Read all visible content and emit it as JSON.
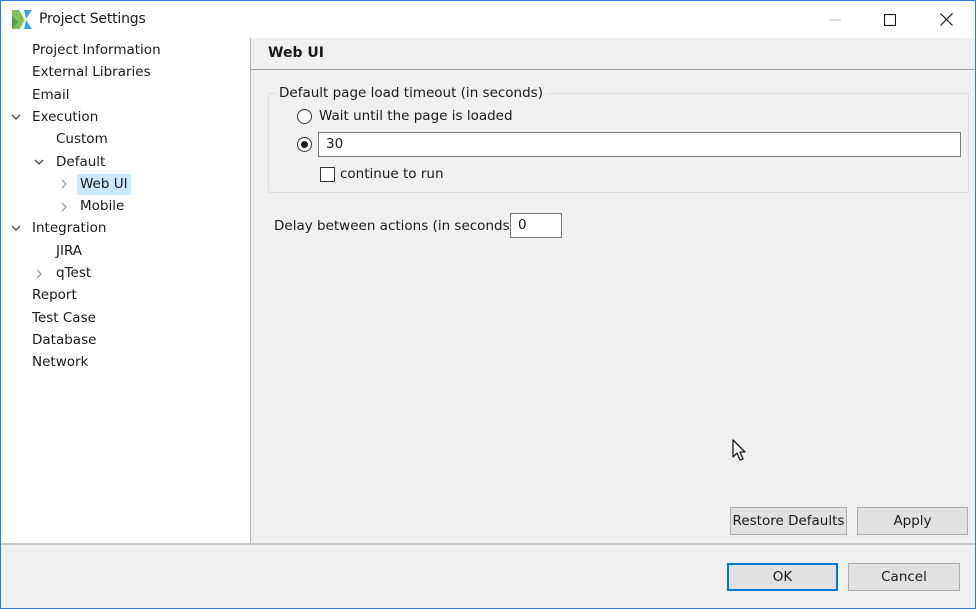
{
  "window": {
    "title": "Project Settings",
    "controls": {
      "minimize": "minimize-icon",
      "maximize": "maximize-icon",
      "close": "close-icon"
    }
  },
  "sidebar": {
    "items": [
      {
        "label": "Project Information",
        "level": 0,
        "twisty": "none"
      },
      {
        "label": "External Libraries",
        "level": 0,
        "twisty": "none"
      },
      {
        "label": "Email",
        "level": 0,
        "twisty": "none"
      },
      {
        "label": "Execution",
        "level": 0,
        "twisty": "expanded"
      },
      {
        "label": "Custom",
        "level": 1,
        "twisty": "none"
      },
      {
        "label": "Default",
        "level": 1,
        "twisty": "expanded"
      },
      {
        "label": "Web UI",
        "level": 2,
        "twisty": "collapsed",
        "selected": true
      },
      {
        "label": "Mobile",
        "level": 2,
        "twisty": "collapsed"
      },
      {
        "label": "Integration",
        "level": 0,
        "twisty": "expanded"
      },
      {
        "label": "JIRA",
        "level": 1,
        "twisty": "none"
      },
      {
        "label": "qTest",
        "level": 1,
        "twisty": "collapsed"
      },
      {
        "label": "Report",
        "level": 0,
        "twisty": "none"
      },
      {
        "label": "Test Case",
        "level": 0,
        "twisty": "none"
      },
      {
        "label": "Database",
        "level": 0,
        "twisty": "none"
      },
      {
        "label": "Network",
        "level": 0,
        "twisty": "none"
      }
    ]
  },
  "main": {
    "title": "Web UI",
    "timeout_group": {
      "legend": "Default page load timeout (in seconds)",
      "wait_option_label": "Wait until the page is loaded",
      "wait_option_checked": false,
      "custom_option_checked": true,
      "custom_value": "30",
      "continue_label": "continue to run",
      "continue_checked": false
    },
    "delay": {
      "label": "Delay between actions (in seconds)",
      "value": "0"
    },
    "buttons": {
      "restore_defaults": "Restore Defaults",
      "apply": "Apply"
    }
  },
  "footer": {
    "ok": "OK",
    "cancel": "Cancel"
  },
  "colors": {
    "accent": "#0078d7",
    "selection": "#cce8ff",
    "window_border": "#2b7fd4"
  }
}
